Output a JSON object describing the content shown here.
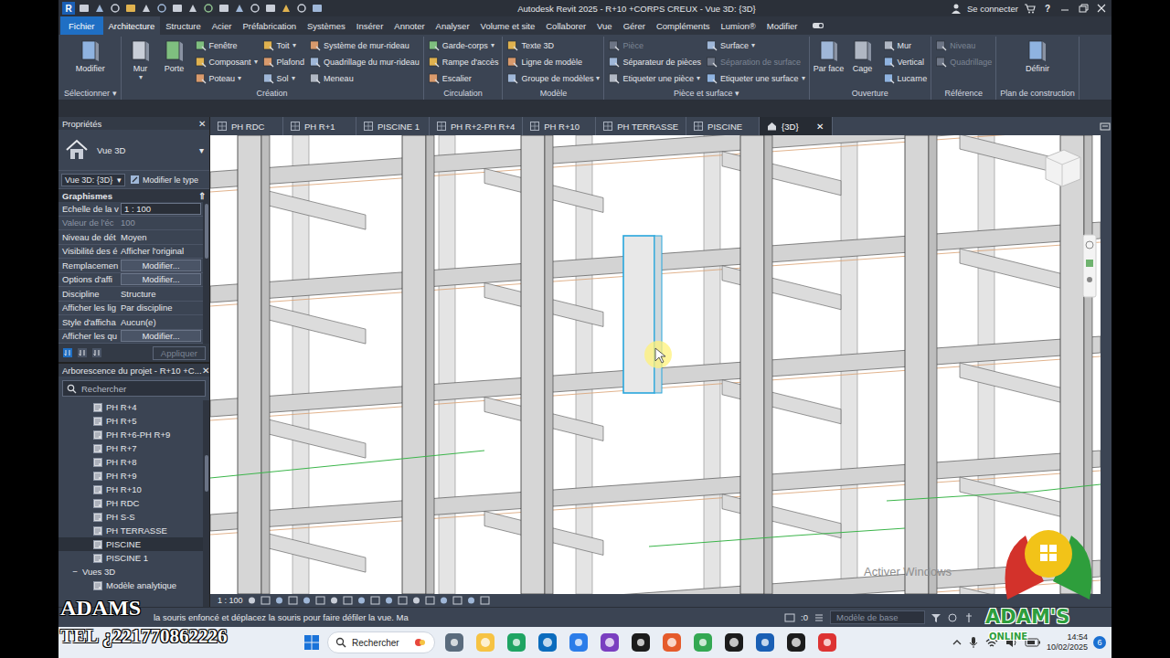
{
  "window": {
    "logo": "R",
    "title": "Autodesk Revit 2025 - R+10 +CORPS CREUX - Vue 3D: {3D}",
    "sign_in": "Se connecter",
    "help": "?"
  },
  "file_tab": {
    "label": "Fichier"
  },
  "ribbon_tabs": [
    {
      "label": "Architecture",
      "selected": true
    },
    {
      "label": "Structure",
      "selected": false
    },
    {
      "label": "Acier",
      "selected": false
    },
    {
      "label": "Préfabrication",
      "selected": false
    },
    {
      "label": "Systèmes",
      "selected": false
    },
    {
      "label": "Insérer",
      "selected": false
    },
    {
      "label": "Annoter",
      "selected": false
    },
    {
      "label": "Analyser",
      "selected": false
    },
    {
      "label": "Volume et site",
      "selected": false
    },
    {
      "label": "Collaborer",
      "selected": false
    },
    {
      "label": "Vue",
      "selected": false
    },
    {
      "label": "Gérer",
      "selected": false
    },
    {
      "label": "Compléments",
      "selected": false
    },
    {
      "label": "Lumion®",
      "selected": false
    },
    {
      "label": "Modifier",
      "selected": false
    }
  ],
  "ribbon_panels": [
    {
      "title": "Sélectionner ▾",
      "columns": [
        {
          "kind": "large",
          "items": [
            {
              "label": "Modifier",
              "disabled": false
            }
          ]
        }
      ]
    },
    {
      "title": "Création",
      "columns": [
        {
          "kind": "large",
          "items": [
            {
              "label": "Mur",
              "arrow": "▾",
              "disabled": false
            },
            {
              "label": "Porte",
              "disabled": false
            }
          ]
        },
        {
          "kind": "small",
          "items": [
            {
              "label": "Fenêtre",
              "disabled": false
            },
            {
              "label": "Composant",
              "arrow": "▾",
              "disabled": false
            },
            {
              "label": "Poteau",
              "arrow": "▾",
              "disabled": false
            }
          ]
        },
        {
          "kind": "small",
          "items": [
            {
              "label": "Toit",
              "arrow": "▾",
              "disabled": false
            },
            {
              "label": "Plafond",
              "disabled": false
            },
            {
              "label": "Sol",
              "arrow": "▾",
              "disabled": false
            }
          ]
        },
        {
          "kind": "small",
          "items": [
            {
              "label": "Système de mur-rideau",
              "disabled": false
            },
            {
              "label": "Quadrillage du mur-rideau",
              "disabled": false
            },
            {
              "label": "Meneau",
              "disabled": false
            }
          ]
        }
      ]
    },
    {
      "title": "Circulation",
      "columns": [
        {
          "kind": "small",
          "items": [
            {
              "label": "Garde-corps",
              "arrow": "▾",
              "disabled": false
            },
            {
              "label": "Rampe d'accès",
              "disabled": false
            },
            {
              "label": "Escalier",
              "disabled": false
            }
          ]
        }
      ]
    },
    {
      "title": "Modèle",
      "columns": [
        {
          "kind": "small",
          "items": [
            {
              "label": "Texte 3D",
              "disabled": false
            },
            {
              "label": "Ligne de modèle",
              "disabled": false
            },
            {
              "label": "Groupe de modèles",
              "arrow": "▾",
              "disabled": false
            }
          ]
        }
      ]
    },
    {
      "title": "Pièce et surface ▾",
      "columns": [
        {
          "kind": "small",
          "items": [
            {
              "label": "Pièce",
              "disabled": true
            },
            {
              "label": "Séparateur de pièces",
              "disabled": false
            },
            {
              "label": "Etiqueter une pièce",
              "arrow": "▾",
              "disabled": false
            }
          ]
        },
        {
          "kind": "small",
          "items": [
            {
              "label": "Surface",
              "arrow": "▾",
              "disabled": false
            },
            {
              "label": "Séparation de surface",
              "disabled": true
            },
            {
              "label": "Etiqueter une surface",
              "arrow": "▾",
              "disabled": false
            }
          ]
        }
      ]
    },
    {
      "title": "Ouverture",
      "columns": [
        {
          "kind": "large",
          "items": [
            {
              "label": "Par face",
              "disabled": false
            },
            {
              "label": "Cage",
              "disabled": false
            }
          ]
        },
        {
          "kind": "small",
          "items": [
            {
              "label": "Mur",
              "disabled": false
            },
            {
              "label": "Vertical",
              "disabled": false
            },
            {
              "label": "Lucarne",
              "disabled": false
            }
          ]
        }
      ]
    },
    {
      "title": "Référence",
      "columns": [
        {
          "kind": "small",
          "items": [
            {
              "label": "Niveau",
              "disabled": true
            },
            {
              "label": "Quadrillage",
              "disabled": true
            }
          ]
        }
      ]
    },
    {
      "title": "Plan de construction",
      "columns": [
        {
          "kind": "large",
          "items": [
            {
              "label": "Définir",
              "disabled": false
            }
          ]
        }
      ]
    }
  ],
  "properties": {
    "title": "Propriétés",
    "close": "✕",
    "type_name": "Vue 3D",
    "type_arrow": "▾",
    "instance": "Vue 3D: {3D}",
    "instance_arrow": "▾",
    "edit_type": "Modifier le type",
    "section": "Graphismes",
    "section_toggle": "⇑",
    "rows": [
      {
        "label": "Echelle de la v",
        "value": "1 : 100",
        "kind": "input",
        "disabled": false
      },
      {
        "label": "Valeur de l'éc",
        "value": "100",
        "kind": "text",
        "disabled": true
      },
      {
        "label": "Niveau de dét",
        "value": "Moyen",
        "kind": "text",
        "disabled": false
      },
      {
        "label": "Visibilité des é",
        "value": "Afficher l'original",
        "kind": "text",
        "disabled": false
      },
      {
        "label": "Remplacemen",
        "value": "Modifier...",
        "kind": "button",
        "disabled": false
      },
      {
        "label": "Options d'affi",
        "value": "Modifier...",
        "kind": "button",
        "disabled": false
      },
      {
        "label": "Discipline",
        "value": "Structure",
        "kind": "text",
        "disabled": false
      },
      {
        "label": "Afficher les lig",
        "value": "Par discipline",
        "kind": "text",
        "disabled": false
      },
      {
        "label": "Style d'afficha",
        "value": "Aucun(e)",
        "kind": "text",
        "disabled": false
      },
      {
        "label": "Afficher les qu",
        "value": "Modifier...",
        "kind": "button",
        "disabled": false
      }
    ],
    "apply": {
      "label": "Appliquer",
      "disabled": true
    }
  },
  "browser": {
    "title": "Arborescence du projet - R+10 +C...",
    "close": "✕",
    "search_placeholder": "Rechercher",
    "items": [
      {
        "label": "PH R+4",
        "kind": "view",
        "selected": false
      },
      {
        "label": "PH R+5",
        "kind": "view",
        "selected": false
      },
      {
        "label": "PH R+6-PH R+9",
        "kind": "view",
        "selected": false
      },
      {
        "label": "PH R+7",
        "kind": "view",
        "selected": false
      },
      {
        "label": "PH R+8",
        "kind": "view",
        "selected": false
      },
      {
        "label": "PH R+9",
        "kind": "view",
        "selected": false
      },
      {
        "label": "PH R+10",
        "kind": "view",
        "selected": false
      },
      {
        "label": "PH RDC",
        "kind": "view",
        "selected": false
      },
      {
        "label": "PH S-S",
        "kind": "view",
        "selected": false
      },
      {
        "label": "PH TERRASSE",
        "kind": "view",
        "selected": false
      },
      {
        "label": "PISCINE",
        "kind": "view",
        "selected": true
      },
      {
        "label": "PISCINE 1",
        "kind": "view",
        "selected": false
      },
      {
        "label": "Vues 3D",
        "kind": "group",
        "toggle": "−",
        "expanded": true,
        "selected": false
      },
      {
        "label": "Modèle analytique",
        "kind": "view",
        "selected": false
      }
    ]
  },
  "view_tabs": [
    {
      "label": "PH RDC",
      "selected": false
    },
    {
      "label": "PH R+1",
      "selected": false
    },
    {
      "label": "PISCINE 1",
      "selected": false
    },
    {
      "label": "PH R+2-PH R+4",
      "selected": false
    },
    {
      "label": "PH R+10",
      "selected": false
    },
    {
      "label": "PH TERRASSE",
      "selected": false
    },
    {
      "label": "PISCINE",
      "selected": false
    },
    {
      "label": "{3D}",
      "selected": true,
      "close": "✕"
    }
  ],
  "view": {
    "scale": "1 : 100",
    "watermark": "Activer Windows"
  },
  "status_bar": {
    "text": "la souris enfoncé et déplacez la souris pour faire défiler la vue. Ma",
    "selection": ":0",
    "model": "Modèle de base"
  },
  "taskbar": {
    "search": "Rechercher",
    "time": "14:54",
    "date": "10/02/2025",
    "badge": "6"
  },
  "overlay": {
    "name": "ADAMS",
    "phone": "TEL ¿221770862226",
    "logo_top": "ADAM'S",
    "logo_bottom": "ONLINE"
  }
}
